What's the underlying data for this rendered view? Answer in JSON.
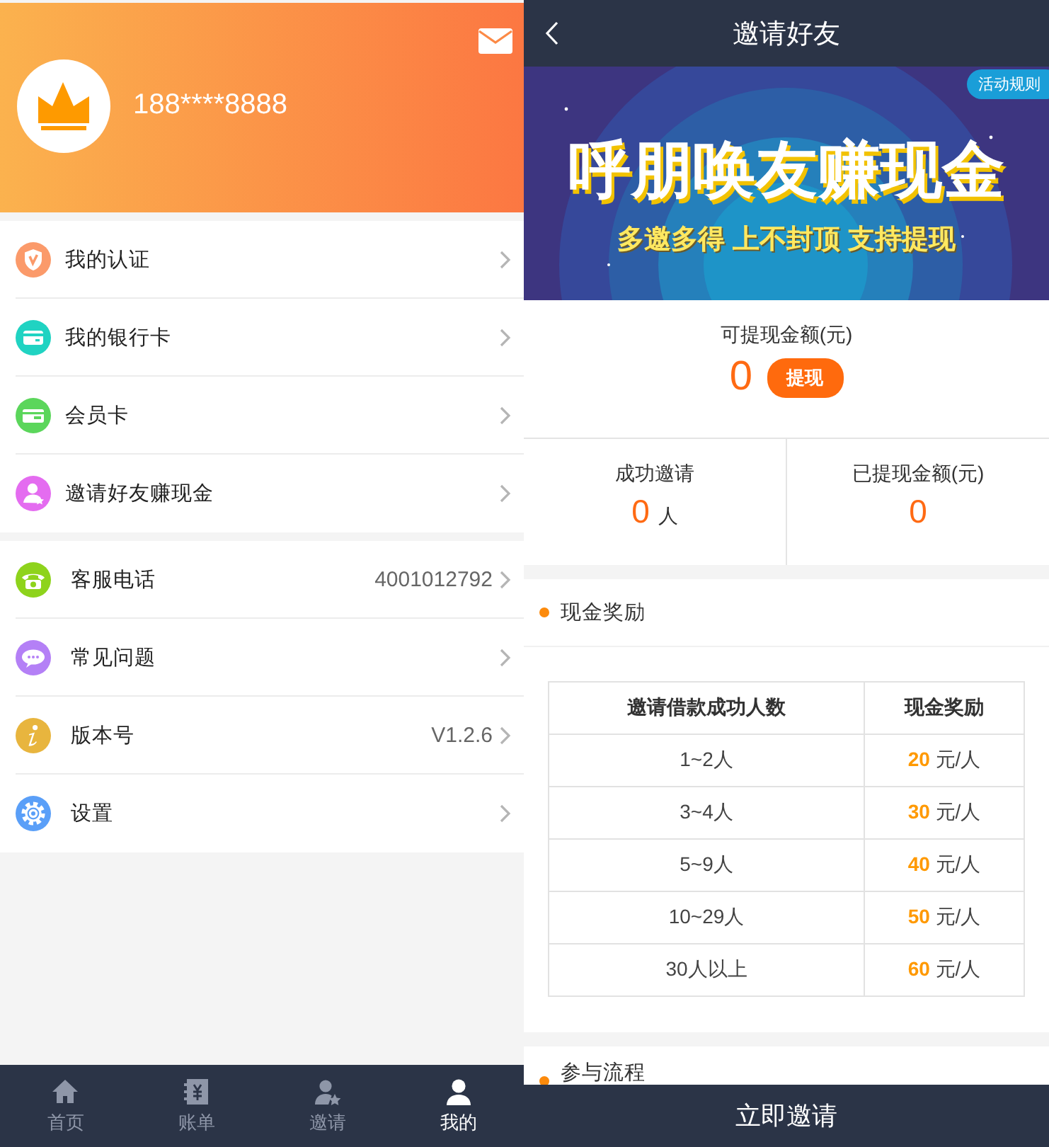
{
  "profile": {
    "phone": "188****8888"
  },
  "menu_groups": [
    [
      {
        "kind": "verify",
        "label": "我的认证"
      },
      {
        "kind": "bank_card",
        "label": "我的银行卡"
      },
      {
        "kind": "vip_card",
        "label": "会员卡"
      },
      {
        "kind": "invite",
        "label": "邀请好友赚现金"
      }
    ],
    [
      {
        "kind": "phone",
        "label": "客服电话",
        "value": "4001012792"
      },
      {
        "kind": "faq",
        "label": "常见问题"
      },
      {
        "kind": "info",
        "label": "版本号",
        "value": "V1.2.6"
      },
      {
        "kind": "settings",
        "label": "设置"
      }
    ]
  ],
  "tab_bar": [
    {
      "kind": "home",
      "label": "首页",
      "selected": false
    },
    {
      "kind": "bill",
      "label": "账单",
      "selected": false
    },
    {
      "kind": "invite",
      "label": "邀请",
      "selected": false
    },
    {
      "kind": "mine",
      "label": "我的",
      "selected": true
    }
  ],
  "invite": {
    "title": "邀请好友",
    "rules_badge": "活动规则",
    "banner_title": "呼朋唤友赚现金",
    "banner_subtitle": "多邀多得 上不封顶 支持提现",
    "balance_label": "可提现金额(元)",
    "balance": "0",
    "withdraw_button": "提现",
    "stats": [
      {
        "label": "成功邀请",
        "value": "0",
        "unit": "人"
      },
      {
        "label": "已提现金额(元)",
        "value": "0"
      }
    ],
    "reward_section": {
      "title": "现金奖励",
      "columns": [
        "邀请借款成功人数",
        "现金奖励"
      ],
      "rows": [
        [
          "1~2人",
          "**20** 元/人"
        ],
        [
          "3~4人",
          "**30** 元/人"
        ],
        [
          "5~9人",
          "**40** 元/人"
        ],
        [
          "10~29人",
          "**50** 元/人"
        ],
        [
          "30人以上",
          "**60** 元/人"
        ]
      ]
    },
    "process_section": {
      "title": "参与流程"
    },
    "invite_button": "立即邀请"
  }
}
